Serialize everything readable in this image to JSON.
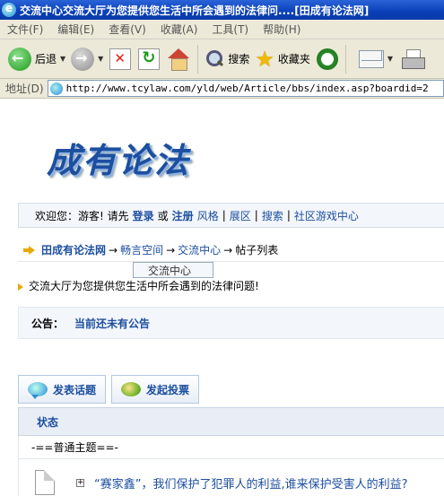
{
  "window": {
    "title": "交流中心交流大厅为您提供您生活中所会遇到的法律问....[田成有论法网]"
  },
  "menu": [
    "文件(F)",
    "编辑(E)",
    "查看(V)",
    "收藏(A)",
    "工具(T)",
    "帮助(H)"
  ],
  "toolbar": {
    "back_label": "后退",
    "search_label": "搜索",
    "favorites_label": "收藏夹"
  },
  "address": {
    "label": "地址(D)",
    "url": "http://www.tcylaw.com/yld/web/Article/bbs/index.asp?boardid=2"
  },
  "site": {
    "logo_text": "成有论法"
  },
  "welcome": {
    "prefix": "欢迎您：游客! 请先",
    "login": "登录",
    "or": "或",
    "register": "注册",
    "links": [
      "风格",
      "展区",
      "搜索",
      "社区游戏中心"
    ],
    "separator": "|"
  },
  "breadcrumb": {
    "home": "田成有论法网",
    "arrow": "→",
    "items": [
      "畅言空间",
      "交流中心",
      "帖子列表"
    ]
  },
  "dropdown": {
    "text": "交流中心"
  },
  "board_description": "交流大厅为您提供您生活中所会遇到的法律问题!",
  "announcement": {
    "label": "公告：",
    "text": "当前还未有公告"
  },
  "actions": {
    "new_topic": "发表话题",
    "new_poll": "发起投票"
  },
  "table": {
    "status_header": "状态",
    "section_label": "-==普通主题==-",
    "topics": [
      {
        "title": "“赛家鑫”，我们保护了犯罪人的利益,谁来保护受害人的利益?"
      }
    ]
  }
}
